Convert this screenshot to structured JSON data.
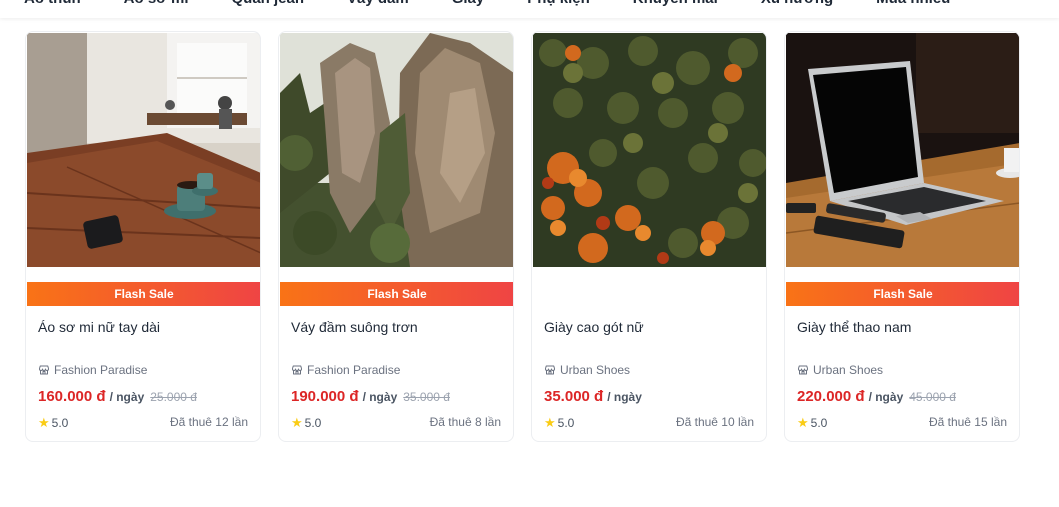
{
  "nav": {
    "items": [
      "Áo thun",
      "Áo sơ mi",
      "Quần jean",
      "Váy đầm",
      "Giày",
      "Phụ kiện",
      "Khuyến mãi",
      "Xu hướng",
      "Mua nhiều"
    ]
  },
  "products": [
    {
      "badge": "Flash Sale",
      "title": "Áo sơ mi nữ tay dài",
      "shop": "Fashion Paradise",
      "price": "160.000 đ",
      "unit": "/ ngày",
      "old_price": "25.000 đ",
      "rating": "5.0",
      "rented": "Đã thuê 12 lần"
    },
    {
      "badge": "Flash Sale",
      "title": "Váy đầm suông trơn",
      "shop": "Fashion Paradise",
      "price": "190.000 đ",
      "unit": "/ ngày",
      "old_price": "35.000 đ",
      "rating": "5.0",
      "rented": "Đã thuê 8 lần"
    },
    {
      "title": "Giày cao gót nữ",
      "shop": "Urban Shoes",
      "price": "35.000 đ",
      "unit": "/ ngày",
      "rating": "5.0",
      "rented": "Đã thuê 10 lần"
    },
    {
      "badge": "Flash Sale",
      "title": "Giày thể thao nam",
      "shop": "Urban Shoes",
      "price": "220.000 đ",
      "unit": "/ ngày",
      "old_price": "45.000 đ",
      "rating": "5.0",
      "rented": "Đã thuê 15 lần"
    }
  ],
  "colors": {
    "price": "#dc2626",
    "badge_start": "#f97316",
    "badge_end": "#ef4444",
    "star": "#facc15"
  },
  "icons": {
    "shop": "store-icon",
    "rating": "star-icon"
  }
}
